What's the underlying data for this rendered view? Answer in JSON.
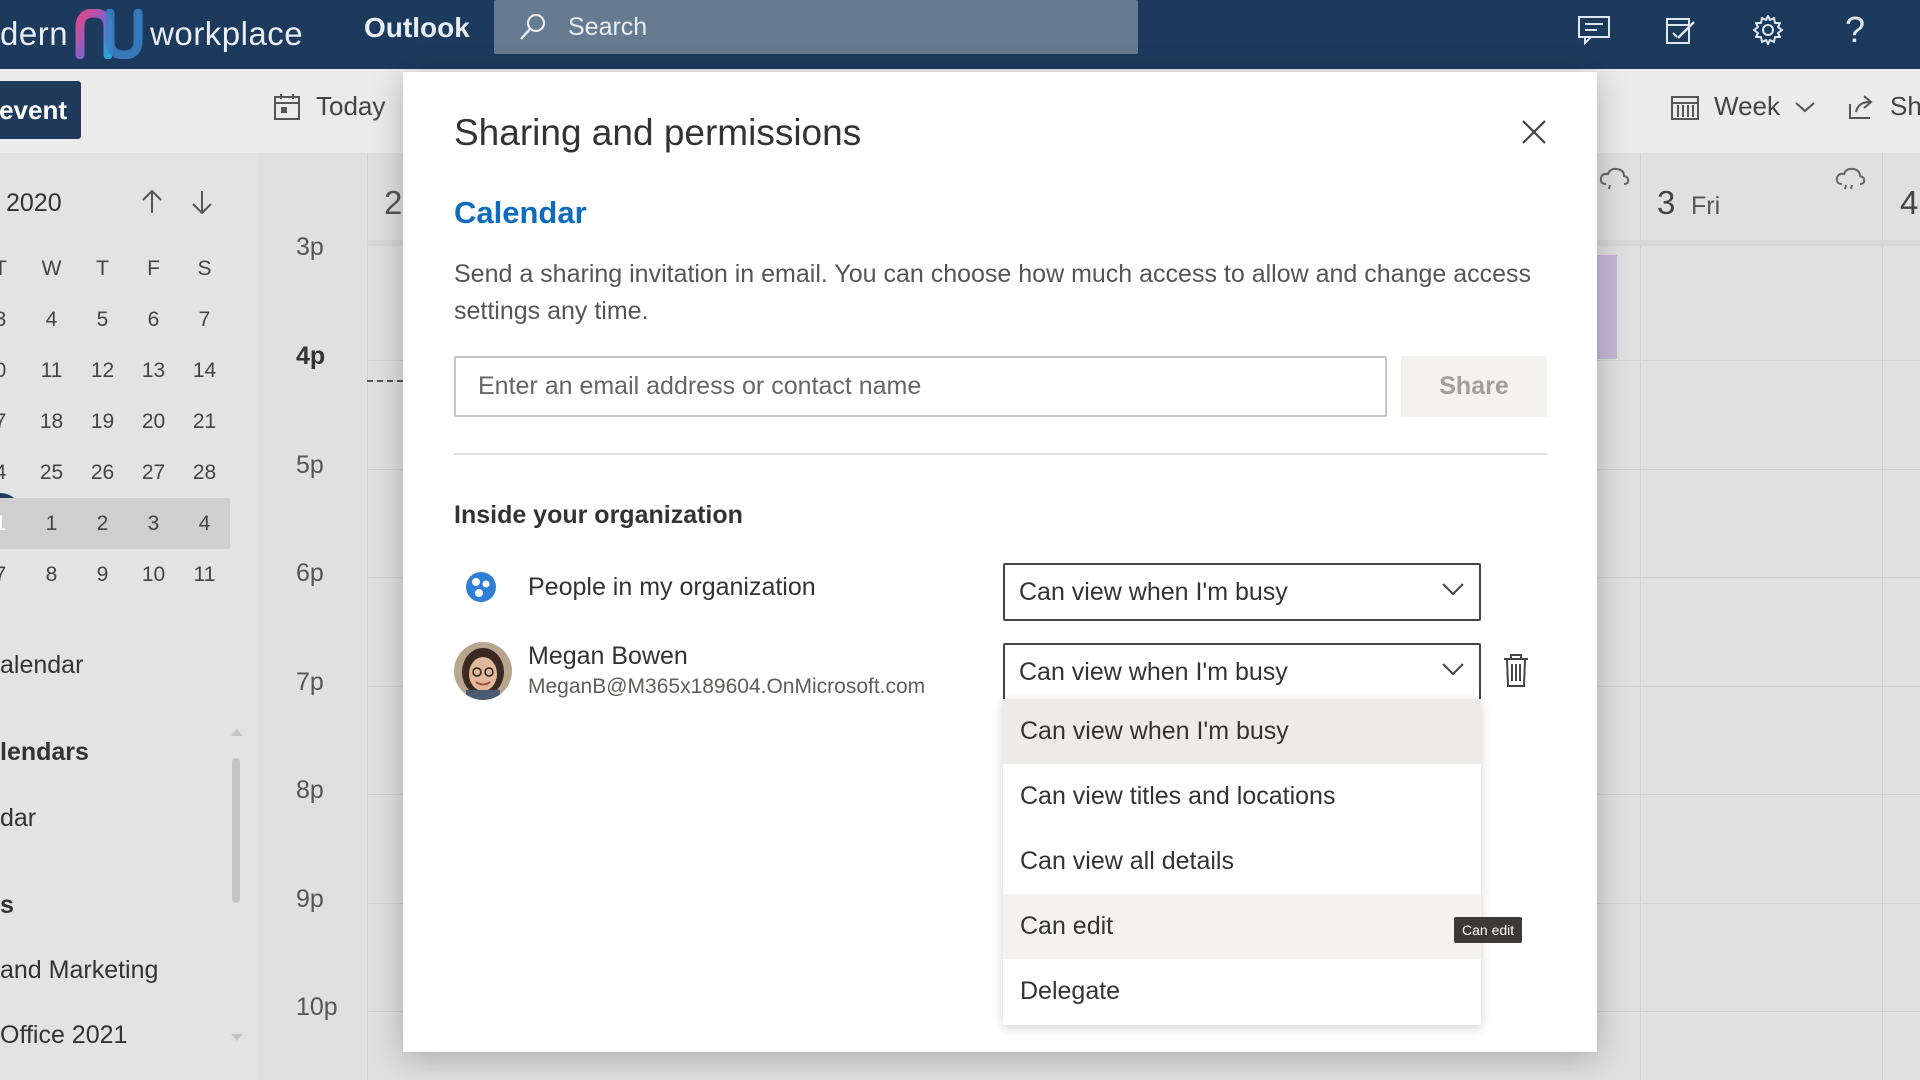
{
  "topbar": {
    "brand_left": "dern",
    "brand_right": "workplace",
    "app_name": "Outlook",
    "search_placeholder": "Search",
    "colors": {
      "bar": "#1c3a5c",
      "search": "#667a90"
    }
  },
  "commandbar": {
    "new_event_label": "event",
    "today_label": "Today",
    "view_label": "Week",
    "share_label": "Sh"
  },
  "leftpane": {
    "month_label": "2020",
    "weekday_headers": [
      "T",
      "W",
      "T",
      "F",
      "S"
    ],
    "weeks": [
      [
        "3",
        "4",
        "5",
        "6",
        "7"
      ],
      [
        "0",
        "11",
        "12",
        "13",
        "14"
      ],
      [
        "7",
        "18",
        "19",
        "20",
        "21"
      ],
      [
        "4",
        "25",
        "26",
        "27",
        "28"
      ],
      [
        "1",
        "1",
        "2",
        "3",
        "4"
      ],
      [
        "7",
        "8",
        "9",
        "10",
        "11"
      ]
    ],
    "items": [
      "alendar",
      "lendars",
      "dar",
      "s",
      "and Marketing",
      "Office 2021"
    ]
  },
  "calendar": {
    "times": [
      "3p",
      "4p",
      "5p",
      "6p",
      "7p",
      "8p",
      "9p",
      "10p"
    ],
    "header_partial_left": "2",
    "day_label_num": "3",
    "day_label_name": "Fri",
    "next_day_num": "4"
  },
  "modal": {
    "title": "Sharing and permissions",
    "section_title": "Calendar",
    "description": "Send a sharing invitation in email. You can choose how much access to allow and change access settings any time.",
    "email_placeholder": "Enter an email address or contact name",
    "share_button": "Share",
    "org_heading": "Inside your organization",
    "org_row": {
      "name": "People in my organization",
      "permission": "Can view when I'm busy"
    },
    "person_row": {
      "name": "Megan Bowen",
      "email": "MeganB@M365x189604.OnMicrosoft.com",
      "permission": "Can view when I'm busy"
    },
    "dropdown_options": [
      "Can view when I'm busy",
      "Can view titles and locations",
      "Can view all details",
      "Can edit",
      "Delegate"
    ],
    "tooltip": "Can edit",
    "accent_color": "#0f6cbd"
  }
}
